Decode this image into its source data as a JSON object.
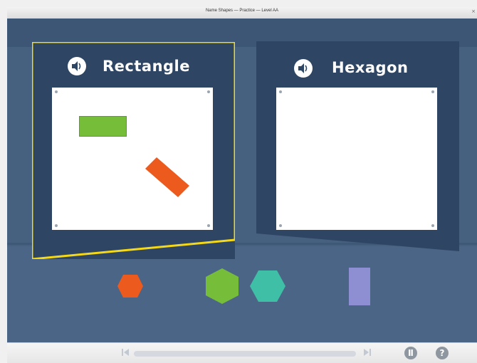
{
  "window": {
    "title": "Name Shapes — Practice — Level AA",
    "close_glyph": "×"
  },
  "colors": {
    "highlight": "#f5d916",
    "green": "#76be3a",
    "orange": "#ec5a1e",
    "teal": "#3fbfa6",
    "purple": "#8e8ed3",
    "stage": "#46607f",
    "panel": "#2f4564"
  },
  "targets": [
    {
      "label": "Rectangle",
      "icon": "speaker-icon",
      "selected": true
    },
    {
      "label": "Hexagon",
      "icon": "speaker-icon",
      "selected": false
    }
  ],
  "bin_shapes": [
    {
      "shape": "hexagon",
      "color": "orange"
    },
    {
      "shape": "hexagon",
      "color": "green"
    },
    {
      "shape": "hexagon",
      "color": "teal"
    },
    {
      "shape": "rectangle",
      "color": "purple"
    }
  ],
  "placed_shapes": [
    {
      "shape": "rectangle",
      "color": "green",
      "board": "Rectangle"
    },
    {
      "shape": "rectangle",
      "color": "orange",
      "board": "Rectangle"
    }
  ],
  "controls": {
    "prev_icon": "skip-back-icon",
    "next_icon": "skip-forward-icon",
    "pause_glyph": "Ⅱ",
    "help_glyph": "?"
  }
}
